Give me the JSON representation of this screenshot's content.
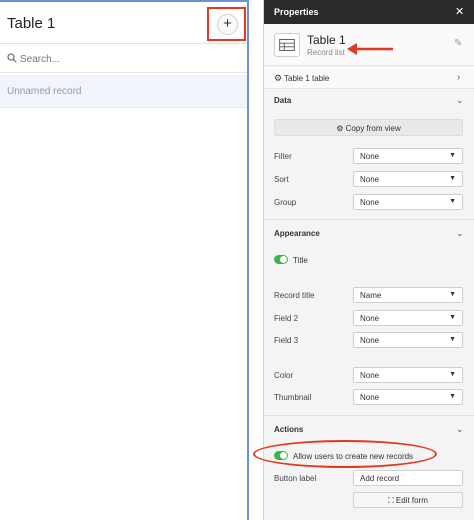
{
  "left": {
    "title": "Table 1",
    "add_label": "+",
    "search_placeholder": "Search...",
    "record": "Unnamed record"
  },
  "properties": {
    "header": "Properties",
    "component": {
      "name": "Table 1",
      "type": "Record list"
    },
    "table_link": "Table 1 table",
    "data": {
      "title": "Data",
      "copy_button": "Copy from view",
      "rows": [
        {
          "label": "Filter",
          "value": "None"
        },
        {
          "label": "Sort",
          "value": "None"
        },
        {
          "label": "Group",
          "value": "None"
        }
      ]
    },
    "appearance": {
      "title": "Appearance",
      "title_toggle": "Title",
      "rows": [
        {
          "label": "Record title",
          "value": "Name"
        },
        {
          "label": "Field 2",
          "value": "None"
        },
        {
          "label": "Field 3",
          "value": "None"
        },
        {
          "label": "Color",
          "value": "None"
        },
        {
          "label": "Thumbnail",
          "value": "None"
        }
      ]
    },
    "actions": {
      "title": "Actions",
      "allow_create": "Allow users to create new records",
      "button_label_label": "Button label",
      "button_label_value": "Add record",
      "edit_form": "Edit form"
    }
  },
  "colors": {
    "selection_blue": "#6f8fd6",
    "annotation_red": "#e1381f",
    "toggle_green": "#3bb54a",
    "panel_header": "#2b2b2b"
  }
}
